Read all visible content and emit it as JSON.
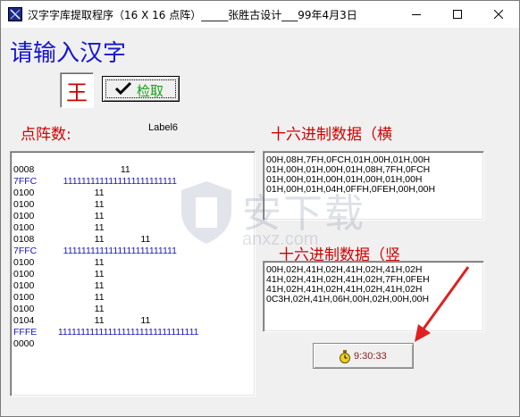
{
  "window": {
    "title": "汉字字库提取程序（16 X 16 点阵）_____张胜古设计___99年4月3日",
    "controls": [
      "minimize-icon",
      "maximize-icon",
      "close-icon"
    ]
  },
  "heading": "请输入汉字",
  "input_char": "王",
  "check_button": {
    "label": "检取",
    "icon": "checkmark-icon"
  },
  "dot_label": "点阵数:",
  "label6": "Label6",
  "hex_h_label": "十六进制数据（横",
  "hex_v_label": "十六进制数据（竖",
  "dot_rows": [
    {
      "hex": "0008",
      "bits": "                          11"
    },
    {
      "hex": "7FFC",
      "bits": "    1111111111111111111111111"
    },
    {
      "hex": "0100",
      "bits": "                11"
    },
    {
      "hex": "0100",
      "bits": "                11"
    },
    {
      "hex": "0100",
      "bits": "                11"
    },
    {
      "hex": "0100",
      "bits": "                11"
    },
    {
      "hex": "0108",
      "bits": "                11              11"
    },
    {
      "hex": "7FFC",
      "bits": "    1111111111111111111111111"
    },
    {
      "hex": "0100",
      "bits": "                11"
    },
    {
      "hex": "0100",
      "bits": "                11"
    },
    {
      "hex": "0100",
      "bits": "                11"
    },
    {
      "hex": "0100",
      "bits": "                11"
    },
    {
      "hex": "0100",
      "bits": "                11"
    },
    {
      "hex": "0104",
      "bits": "                11              11"
    },
    {
      "hex": "FFFE",
      "bits": "  1111111111111111111111111111111"
    },
    {
      "hex": "0000",
      "bits": ""
    }
  ],
  "hex_horizontal": [
    "00H,08H,7FH,0FCH,01H,00H,01H,00H",
    "01H,00H,01H,00H,01H,08H,7FH,0FCH",
    "01H,00H,01H,00H,01H,00H,01H,00H",
    "01H,00H,01H,04H,0FFH,0FEH,00H,00H"
  ],
  "hex_vertical": [
    "00H,02H,41H,02H,41H,02H,41H,02H",
    "41H,02H,41H,02H,41H,02H,7FH,0FEH",
    "41H,02H,41H,02H,41H,02H,41H,02H",
    "0C3H,02H,41H,06H,00H,02H,00H,00H"
  ],
  "time_button": {
    "label": "9:30:33",
    "icon": "stopwatch-icon"
  },
  "watermark": {
    "cn": "安下载",
    "en": "anxz.com"
  },
  "colors": {
    "heading": "#1515d0",
    "red": "#d00000",
    "green": "#18a018",
    "arrow": "#e02020"
  }
}
